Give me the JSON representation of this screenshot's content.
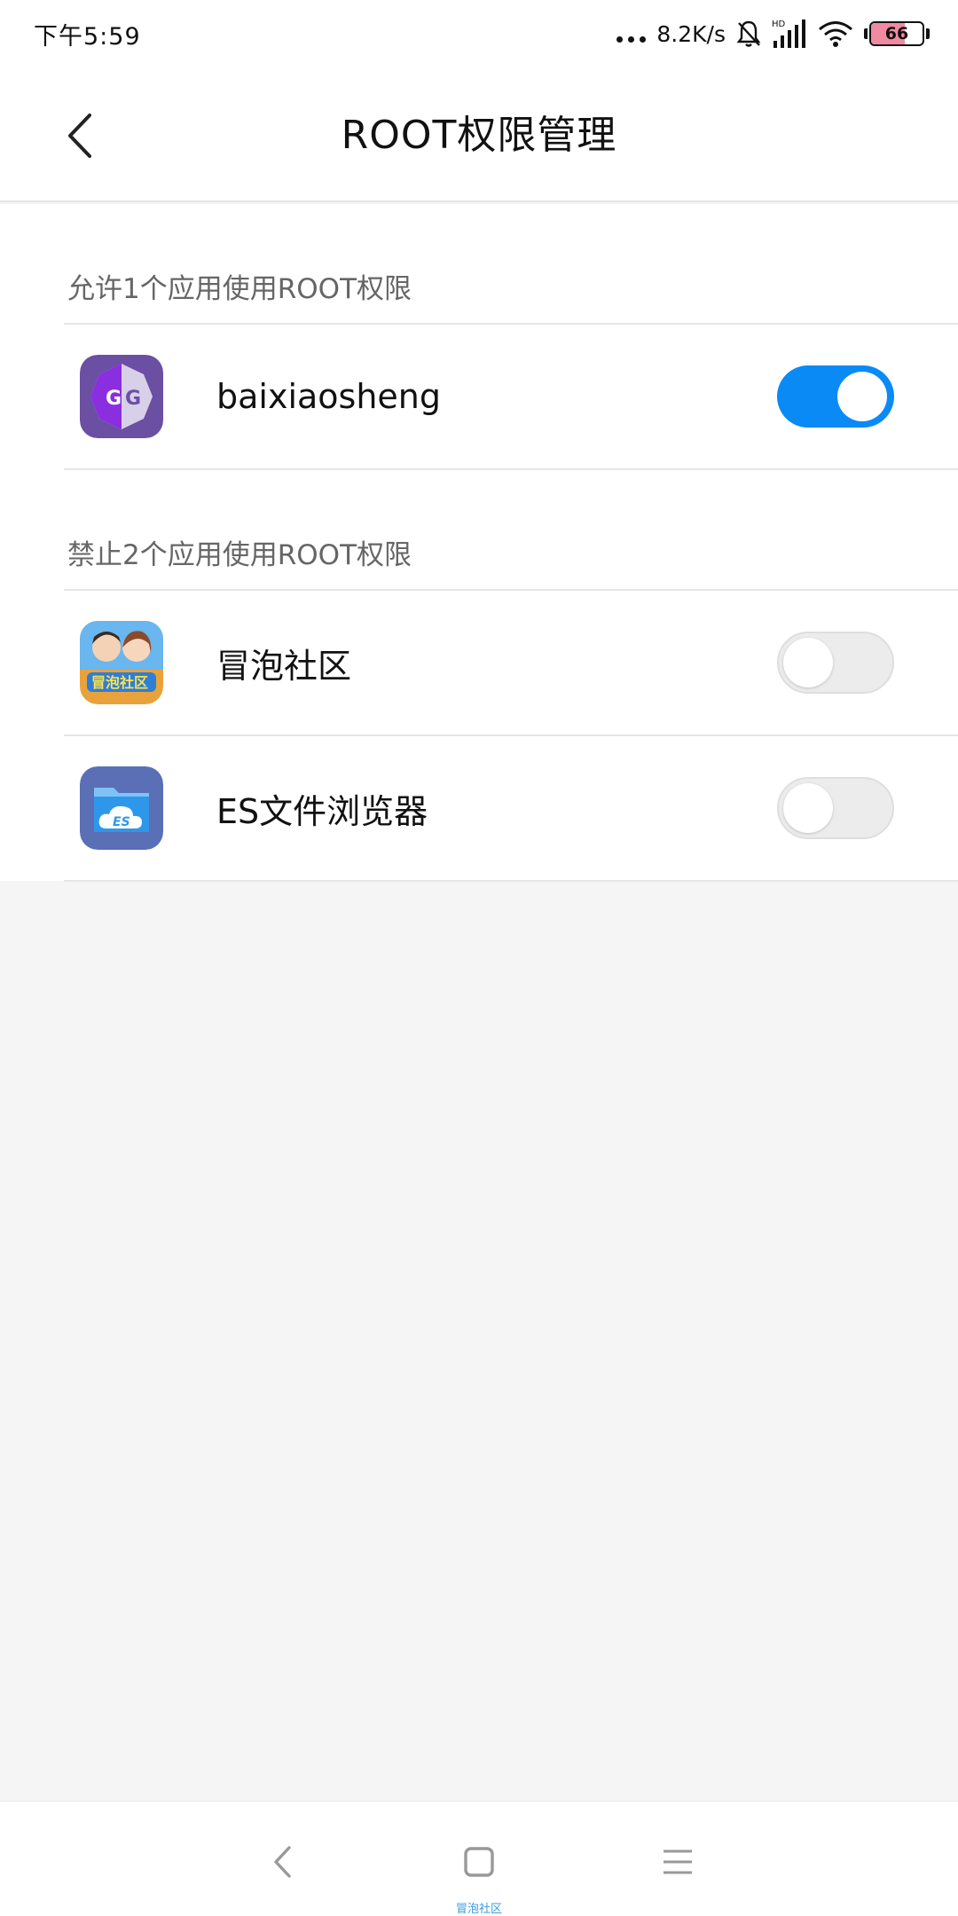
{
  "status_bar": {
    "time": "下午5:59",
    "net_speed": "8.2K/s",
    "network": "HD",
    "battery_level": "66",
    "battery_percent": 66,
    "icons": [
      "more-dots-icon",
      "bell-mute-icon",
      "signal-icon",
      "wifi-icon",
      "battery-icon"
    ]
  },
  "header": {
    "title": "ROOT权限管理",
    "back_icon": "back-chevron-icon"
  },
  "allowed_section": {
    "label": "允许1个应用使用ROOT权限",
    "apps": [
      {
        "name": "baixiaosheng",
        "icon": "gameguardian-icon",
        "enabled": true
      }
    ]
  },
  "denied_section": {
    "label": "禁止2个应用使用ROOT权限",
    "apps": [
      {
        "name": "冒泡社区",
        "icon": "maopao-icon",
        "enabled": false
      },
      {
        "name": "ES文件浏览器",
        "icon": "es-file-explorer-icon",
        "enabled": false
      }
    ]
  },
  "nav_bar": {
    "items": [
      "back-icon",
      "home-icon",
      "menu-icon"
    ],
    "watermark": "冒泡社区"
  },
  "colors": {
    "accent": "#0a8af5",
    "background": "#f5f5f5",
    "surface": "#ffffff"
  }
}
